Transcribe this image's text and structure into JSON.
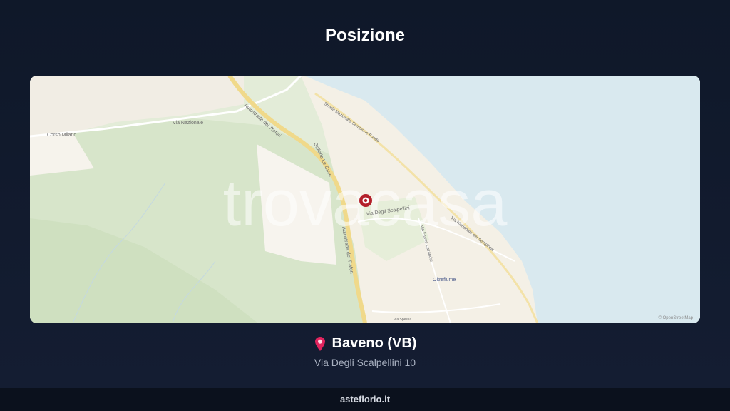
{
  "header": {
    "title": "Posizione"
  },
  "map": {
    "watermark": "trovacasa",
    "attribution": "© OpenStreetMap",
    "labels": {
      "corso_milano": "Corso Milano",
      "via_nazionale": "Via Nazionale",
      "autostrada_1": "Autostrada dei Trafori",
      "autostrada_2": "Autostrada dei Trafori",
      "galleria": "Galleria Le Cave",
      "strada_sempione_1": "Strada Nazionale Sempione Fondo",
      "strada_sempione_2": "Via Nazionale del Sempione",
      "via_scalpellini": "Via Degli Scalpellini",
      "oltrefiume": "Oltrefiume",
      "via_lavandai": "Via Fiume Lavandai",
      "via_feriolo": "Via Feriolo",
      "via_spessa": "Via Spessa"
    },
    "colors": {
      "water": "#d9e9ef",
      "vegetation": "#dbe8cf",
      "urban": "#f5f1e8",
      "motorway": "#f0d98a",
      "marker": "#b3202a"
    }
  },
  "location": {
    "name": "Baveno (VB)",
    "address": "Via Degli Scalpellini 10"
  },
  "footer": {
    "site": "asteflorio.it"
  }
}
